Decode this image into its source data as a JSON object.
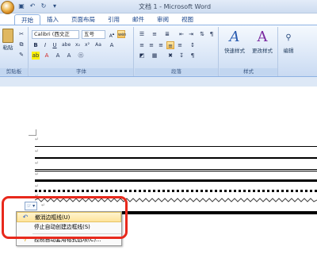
{
  "window": {
    "title": "文档 1 - Microsoft Word"
  },
  "qat": {
    "save_icon": "save-icon",
    "undo_icon": "undo-icon",
    "redo_icon": "redo-icon"
  },
  "tabs": [
    {
      "label": "开始",
      "active": true
    },
    {
      "label": "插入"
    },
    {
      "label": "页面布局"
    },
    {
      "label": "引用"
    },
    {
      "label": "邮件"
    },
    {
      "label": "审阅"
    },
    {
      "label": "视图"
    }
  ],
  "ribbon": {
    "clipboard": {
      "paste_label": "粘贴",
      "group_label": "剪贴板"
    },
    "font": {
      "font_name": "Calibri (西文正",
      "font_size": "五号",
      "wen_label": "wén",
      "group_label": "字体"
    },
    "paragraph": {
      "group_label": "段落"
    },
    "styles": {
      "quick_styles_label": "快速样式",
      "change_styles_label": "更改样式",
      "group_label": "样式"
    },
    "editing": {
      "label": "编辑"
    }
  },
  "document": {
    "para_mark": "↵"
  },
  "popup": {
    "button_label": "☞ ▾",
    "items": [
      {
        "label": "撤消边框线(U)",
        "highlighted": true
      },
      {
        "label": "停止自动创建边框线(S)"
      },
      {
        "label": "控制自动套用格式选项(C)..."
      }
    ]
  },
  "colors": {
    "highlight_box": "#e8291c",
    "ribbon_bg": "#dbe7f7"
  }
}
